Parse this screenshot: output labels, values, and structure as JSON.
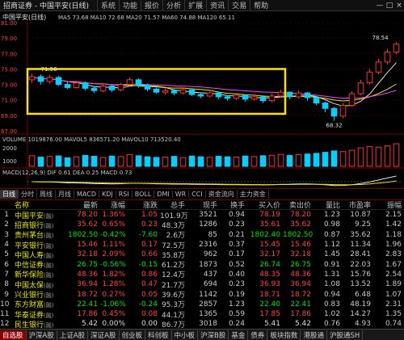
{
  "window": {
    "app_title": "招商证券 - 中国平安(日线)",
    "menu": [
      "系统",
      "功能",
      "报价",
      "分析",
      "扩展",
      "资讯",
      "交易",
      "帮助"
    ],
    "controls": [
      "—",
      "□",
      "×"
    ]
  },
  "chart": {
    "title": "中国平安(日线)",
    "ma_line": "MA5 73.68  MA10 72.68  MA20 71.57  MA60 74.88  MA120 65.11",
    "high_label": "78.54",
    "low_label": "68.32",
    "left_label": "71.56",
    "price_ticks": [
      "81.00",
      "79.00",
      "77.00",
      "75.00",
      "73.00",
      "71.00",
      "69.00",
      "67.00"
    ],
    "vol_line": "VOLUME 1019876.00  MAVOL5 836571.20  MAVOL10 713520.40",
    "vol_ticks": [
      "2000",
      "1000"
    ],
    "macd_line": "MACD(12,26,9) DIF 0.61  DEA 0.25  MACD 0.73",
    "macd_ticks": [
      "1.00",
      "0.00",
      "-1.00"
    ],
    "colors": {
      "up": "#ff3030",
      "down": "#00d0ff",
      "ma5": "#e0e0e0",
      "ma10": "#e6e600",
      "ma20": "#ff40ff",
      "ma60": "#40ff40",
      "highlight_box": "#ffe000"
    }
  },
  "chart_data": {
    "type": "candlestick",
    "title": "中国平安(日线)",
    "candles": [
      {
        "o": 73.6,
        "c": 74.0,
        "h": 74.4,
        "l": 73.2
      },
      {
        "o": 74.0,
        "c": 73.4,
        "h": 74.3,
        "l": 73.0
      },
      {
        "o": 73.4,
        "c": 73.9,
        "h": 74.2,
        "l": 73.1
      },
      {
        "o": 73.9,
        "c": 73.0,
        "h": 74.1,
        "l": 72.8
      },
      {
        "o": 73.0,
        "c": 72.6,
        "h": 73.3,
        "l": 72.4
      },
      {
        "o": 72.6,
        "c": 73.2,
        "h": 73.5,
        "l": 72.5
      },
      {
        "o": 73.2,
        "c": 72.5,
        "h": 73.4,
        "l": 72.2
      },
      {
        "o": 72.5,
        "c": 72.2,
        "h": 72.8,
        "l": 71.9
      },
      {
        "o": 72.2,
        "c": 72.8,
        "h": 73.0,
        "l": 72.0
      },
      {
        "o": 72.8,
        "c": 72.3,
        "h": 73.0,
        "l": 72.0
      },
      {
        "o": 72.3,
        "c": 73.0,
        "h": 73.2,
        "l": 72.1
      },
      {
        "o": 73.0,
        "c": 73.6,
        "h": 73.9,
        "l": 72.8
      },
      {
        "o": 73.6,
        "c": 72.9,
        "h": 73.8,
        "l": 72.6
      },
      {
        "o": 72.9,
        "c": 72.4,
        "h": 73.1,
        "l": 72.1
      },
      {
        "o": 72.4,
        "c": 72.0,
        "h": 72.6,
        "l": 71.8
      },
      {
        "o": 72.0,
        "c": 72.2,
        "h": 72.5,
        "l": 71.7
      },
      {
        "o": 72.2,
        "c": 71.9,
        "h": 72.4,
        "l": 71.6
      },
      {
        "o": 71.9,
        "c": 72.3,
        "h": 72.6,
        "l": 71.7
      },
      {
        "o": 72.3,
        "c": 71.7,
        "h": 72.4,
        "l": 71.5
      },
      {
        "o": 71.7,
        "c": 71.5,
        "h": 71.9,
        "l": 71.2
      },
      {
        "o": 71.5,
        "c": 71.9,
        "h": 72.1,
        "l": 71.3
      },
      {
        "o": 71.9,
        "c": 71.4,
        "h": 72.0,
        "l": 71.1
      },
      {
        "o": 71.4,
        "c": 71.2,
        "h": 71.6,
        "l": 70.9
      },
      {
        "o": 71.2,
        "c": 71.6,
        "h": 71.9,
        "l": 71.0
      },
      {
        "o": 71.6,
        "c": 71.1,
        "h": 71.7,
        "l": 70.8
      },
      {
        "o": 71.1,
        "c": 71.4,
        "h": 71.7,
        "l": 70.9
      },
      {
        "o": 71.4,
        "c": 70.9,
        "h": 71.5,
        "l": 70.6
      },
      {
        "o": 70.9,
        "c": 71.5,
        "h": 71.8,
        "l": 70.7
      },
      {
        "o": 71.5,
        "c": 72.0,
        "h": 72.3,
        "l": 71.3
      },
      {
        "o": 72.0,
        "c": 71.4,
        "h": 72.1,
        "l": 71.1
      },
      {
        "o": 71.4,
        "c": 71.9,
        "h": 72.2,
        "l": 71.2
      },
      {
        "o": 71.9,
        "c": 71.3,
        "h": 72.0,
        "l": 70.9
      },
      {
        "o": 71.3,
        "c": 70.6,
        "h": 71.5,
        "l": 70.3
      },
      {
        "o": 70.6,
        "c": 69.9,
        "h": 70.8,
        "l": 69.4
      },
      {
        "o": 69.9,
        "c": 68.9,
        "h": 70.1,
        "l": 68.3
      },
      {
        "o": 68.9,
        "c": 70.3,
        "h": 70.6,
        "l": 68.6
      },
      {
        "o": 70.3,
        "c": 71.8,
        "h": 72.1,
        "l": 70.1
      },
      {
        "o": 71.8,
        "c": 73.2,
        "h": 73.6,
        "l": 71.6
      },
      {
        "o": 73.2,
        "c": 74.6,
        "h": 75.0,
        "l": 73.0
      },
      {
        "o": 74.6,
        "c": 75.9,
        "h": 76.3,
        "l": 74.3
      },
      {
        "o": 75.9,
        "c": 77.2,
        "h": 77.6,
        "l": 75.6
      },
      {
        "o": 77.2,
        "c": 78.2,
        "h": 78.5,
        "l": 76.9
      }
    ],
    "volumes": [
      620,
      540,
      580,
      610,
      500,
      560,
      640,
      590,
      520,
      600,
      570,
      680,
      620,
      560,
      520,
      540,
      580,
      510,
      600,
      560,
      530,
      590,
      560,
      540,
      600,
      570,
      620,
      650,
      700,
      640,
      680,
      720,
      760,
      820,
      900,
      860,
      940,
      1080,
      1150,
      1120,
      1200,
      1320
    ],
    "price_ylim": [
      67,
      81
    ],
    "highlight_region": "candles 1-28",
    "grid": true
  },
  "indicator_tabs": [
    "日线",
    "分时",
    "周线",
    "月线",
    "MACD",
    "KDJ",
    "RSI",
    "BOLL",
    "DMI",
    "WR",
    "CCI",
    "资金流向",
    "主力资金"
  ],
  "table": {
    "headers": [
      "",
      "名称",
      "最新",
      "涨幅",
      "涨跌",
      "总手",
      "现手",
      "换手",
      "买入价",
      "卖出价",
      "量比",
      "市盈率",
      "振幅"
    ],
    "rows": [
      {
        "idx": "1",
        "name": "中国平安",
        "tag": "(融)",
        "price": "78.20",
        "chg_pct": "1.36%",
        "chg": "1.05",
        "vol": "101.9万",
        "cur": "3521",
        "turn": "0.94",
        "bid": "78.19",
        "ask": "78.20",
        "vr": "1.23",
        "pe": "10.87",
        "amp": "2.15",
        "dir": "up"
      },
      {
        "idx": "2",
        "name": "招商银行",
        "tag": "(融)",
        "price": "35.62",
        "chg_pct": "0.65%",
        "chg": "0.23",
        "vol": "48.3万",
        "cur": "1286",
        "turn": "0.23",
        "bid": "35.61",
        "ask": "35.62",
        "vr": "0.98",
        "pe": "9.25",
        "amp": "1.42",
        "dir": "up"
      },
      {
        "idx": "3",
        "name": "贵州茅台",
        "tag": "(融)",
        "price": "1802.50",
        "chg_pct": "-0.42%",
        "chg": "-7.60",
        "vol": "2.6万",
        "cur": "85",
        "turn": "0.21",
        "bid": "1802.40",
        "ask": "1802.50",
        "vr": "0.87",
        "pe": "35.62",
        "amp": "1.18",
        "dir": "dn"
      },
      {
        "idx": "4",
        "name": "平安银行",
        "tag": "(融)",
        "price": "15.46",
        "chg_pct": "1.11%",
        "chg": "0.17",
        "vol": "72.5万",
        "cur": "2316",
        "turn": "0.37",
        "bid": "15.45",
        "ask": "15.46",
        "vr": "1.12",
        "pe": "11.34",
        "amp": "1.96",
        "dir": "up"
      },
      {
        "idx": "5",
        "name": "中国人寿",
        "tag": "(融)",
        "price": "32.18",
        "chg_pct": "2.09%",
        "chg": "0.66",
        "vol": "35.8万",
        "cur": "962",
        "turn": "0.17",
        "bid": "32.17",
        "ask": "32.18",
        "vr": "1.45",
        "pe": "28.41",
        "amp": "2.83",
        "dir": "up"
      },
      {
        "idx": "6",
        "name": "中信证券",
        "tag": "(融)",
        "price": "26.75",
        "chg_pct": "-0.56%",
        "chg": "-0.15",
        "vol": "61.2万",
        "cur": "1873",
        "turn": "0.52",
        "bid": "26.74",
        "ask": "26.75",
        "vr": "0.91",
        "pe": "22.03",
        "amp": "1.67",
        "dir": "dn"
      },
      {
        "idx": "7",
        "name": "新华保险",
        "tag": "(融)",
        "price": "48.36",
        "chg_pct": "1.82%",
        "chg": "0.86",
        "vol": "12.4万",
        "cur": "437",
        "turn": "0.40",
        "bid": "48.35",
        "ask": "48.36",
        "vr": "1.31",
        "pe": "15.76",
        "amp": "2.54",
        "dir": "up"
      },
      {
        "idx": "8",
        "name": "中国太保",
        "tag": "(融)",
        "price": "36.94",
        "chg_pct": "1.28%",
        "chg": "0.47",
        "vol": "21.7万",
        "cur": "694",
        "turn": "0.23",
        "bid": "36.93",
        "ask": "36.94",
        "vr": "1.08",
        "pe": "13.52",
        "amp": "1.89",
        "dir": "up"
      },
      {
        "idx": "9",
        "name": "兴业银行",
        "tag": "(融)",
        "price": "18.72",
        "chg_pct": "0.27%",
        "chg": "0.05",
        "vol": "39.6万",
        "cur": "1142",
        "turn": "0.19",
        "bid": "18.71",
        "ask": "18.72",
        "vr": "0.94",
        "pe": "6.48",
        "amp": "1.07",
        "dir": "up"
      },
      {
        "idx": "10",
        "name": "东方财富",
        "tag": "(融)",
        "price": "22.41",
        "chg_pct": "-1.06%",
        "chg": "-0.24",
        "vol": "95.3万",
        "cur": "2857",
        "turn": "1.23",
        "bid": "22.40",
        "ask": "22.41",
        "vr": "0.83",
        "pe": "48.19",
        "amp": "2.31",
        "dir": "dn"
      },
      {
        "idx": "11",
        "name": "华泰证券",
        "tag": "(融)",
        "price": "17.86",
        "chg_pct": "0.45%",
        "chg": "0.08",
        "vol": "44.1万",
        "cur": "1365",
        "turn": "0.59",
        "bid": "17.85",
        "ask": "17.86",
        "vr": "1.02",
        "pe": "14.27",
        "amp": "1.35",
        "dir": "up"
      },
      {
        "idx": "12",
        "name": "民生银行",
        "tag": "(融)",
        "price": "5.42",
        "chg_pct": "0.00%",
        "chg": "0.00",
        "vol": "86.7万",
        "cur": "3018",
        "turn": "0.24",
        "bid": "5.41",
        "ask": "5.42",
        "vr": "0.76",
        "pe": "4.93",
        "amp": "0.74",
        "dir": "wh"
      }
    ]
  },
  "tabs": [
    {
      "label": "自选股",
      "active": true
    },
    {
      "label": "沪深A股"
    },
    {
      "label": "上证A股"
    },
    {
      "label": "深证A股"
    },
    {
      "label": "创业板"
    },
    {
      "label": "科创板"
    },
    {
      "label": "中小板"
    },
    {
      "label": "沪深B股"
    },
    {
      "label": "基金"
    },
    {
      "label": "债券"
    },
    {
      "label": "板块指数"
    },
    {
      "label": "港股通"
    },
    {
      "label": "沪股通SH"
    }
  ]
}
